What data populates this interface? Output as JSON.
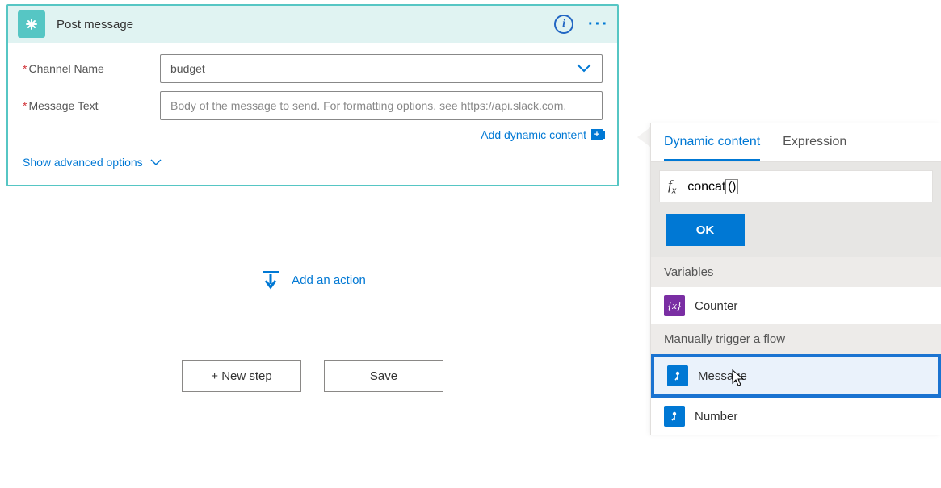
{
  "card": {
    "title": "Post message",
    "channel_label": "Channel Name",
    "channel_value": "budget",
    "message_label": "Message Text",
    "message_placeholder": "Body of the message to send. For formatting options, see https://api.slack.com.",
    "add_dynamic": "Add dynamic content",
    "show_advanced": "Show advanced options"
  },
  "actions": {
    "add_action": "Add an action",
    "new_step": "+ New step",
    "save": "Save"
  },
  "panel": {
    "tab_dynamic": "Dynamic content",
    "tab_expression": "Expression",
    "formula_prefix": "concat",
    "formula_paren": "()",
    "ok": "OK",
    "section_variables": "Variables",
    "item_counter": "Counter",
    "section_trigger": "Manually trigger a flow",
    "item_message": "Message",
    "item_number": "Number"
  }
}
